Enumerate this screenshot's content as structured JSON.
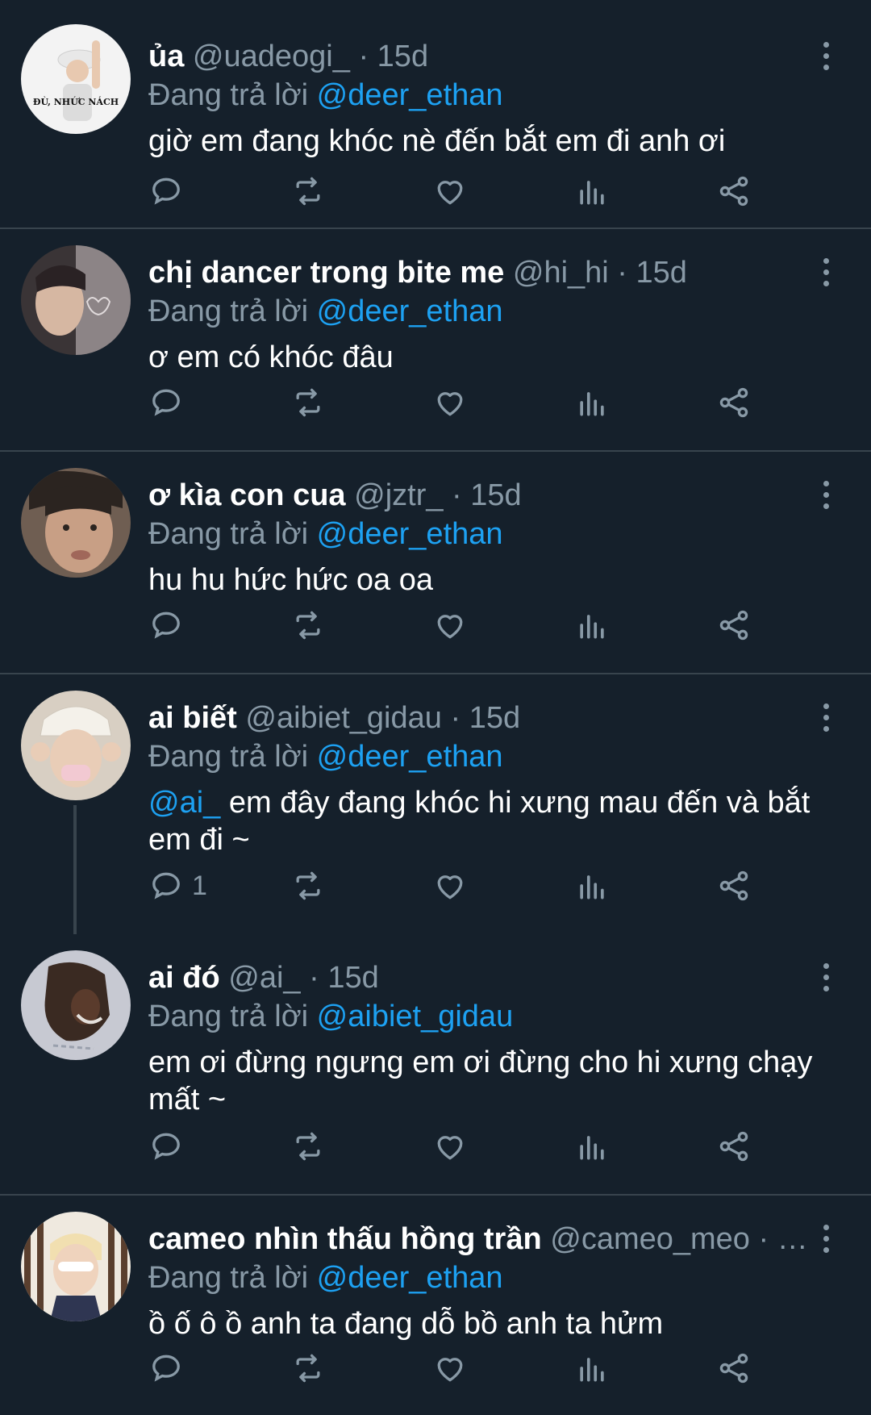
{
  "reply_prefix": "Đang trả lời",
  "tweets": [
    {
      "name": "ủa",
      "handle": "@uadeogi_",
      "sep": " · ",
      "time": "15d",
      "replying_to": "@deer_ethan",
      "mention": "",
      "text": "giờ em đang khóc nè đến bắt em đi anh ơi",
      "reply_count": "",
      "avatar_caption": "ĐÙ, NHỨC NÁCH"
    },
    {
      "name": "chị dancer trong bite me",
      "handle": "@hi_hi",
      "sep": " · ",
      "time": "15d",
      "replying_to": "@deer_ethan",
      "mention": "",
      "text": "ơ em có khóc đâu",
      "reply_count": ""
    },
    {
      "name": "ơ kìa con cua",
      "handle": "@jztr_",
      "sep": " · ",
      "time": "15d",
      "replying_to": "@deer_ethan",
      "mention": "",
      "text": "hu hu hức hức oa oa",
      "reply_count": ""
    },
    {
      "name": "ai biết",
      "handle": "@aibiet_gidau",
      "sep": " · ",
      "time": "15d",
      "replying_to": "@deer_ethan",
      "mention": "@ai_",
      "text": " em đây đang khóc hi xưng mau đến và bắt em đi ~",
      "reply_count": "1"
    },
    {
      "name": "ai đó",
      "handle": "@ai_",
      "sep": " · ",
      "time": "15d",
      "replying_to": "@aibiet_gidau",
      "mention": "",
      "text": "em ơi đừng ngưng em ơi đừng cho hi xưng chạy mất ~",
      "reply_count": ""
    },
    {
      "name": "cameo nhìn thấu hồng trần",
      "handle": "@cameo_meo",
      "sep": " · …",
      "time": "",
      "replying_to": "@deer_ethan",
      "mention": "",
      "text": "ồ ố ô ồ anh ta đang dỗ bồ anh ta hửm",
      "reply_count": ""
    }
  ],
  "icons": {
    "reply": "reply-icon",
    "retweet": "retweet-icon",
    "like": "like-icon",
    "analytics": "analytics-icon",
    "share": "share-icon",
    "more": "more-vertical-icon"
  },
  "colors": {
    "background": "#15202b",
    "separator": "#38444d",
    "muted": "#8899a6",
    "mention": "#1da1f2",
    "text": "#ffffff"
  }
}
